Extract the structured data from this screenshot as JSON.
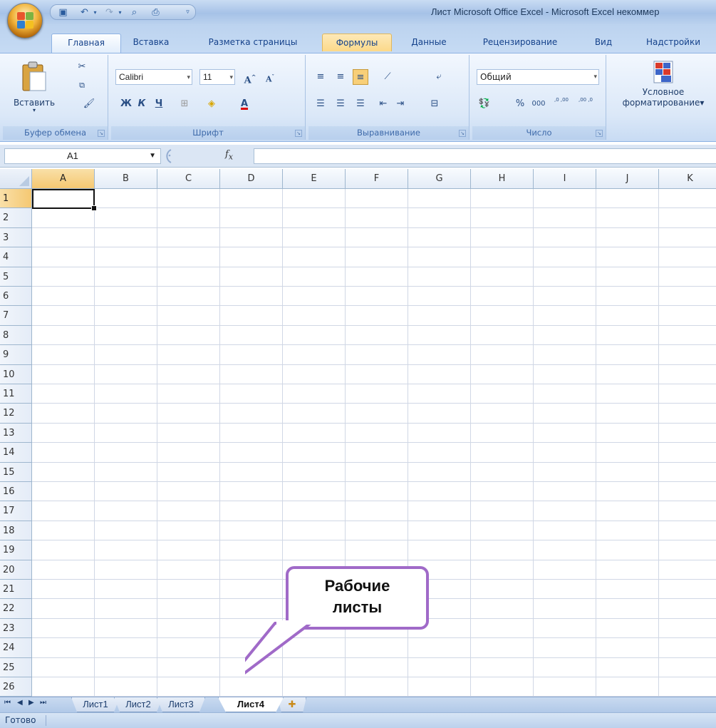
{
  "window": {
    "title": "Лист Microsoft Office Excel - Microsoft Excel некоммер"
  },
  "ribbon_tabs": [
    {
      "label": "Главная",
      "active": true
    },
    {
      "label": "Вставка"
    },
    {
      "label": "Разметка страницы"
    },
    {
      "label": "Формулы",
      "highlighted": true
    },
    {
      "label": "Данные"
    },
    {
      "label": "Рецензирование"
    },
    {
      "label": "Вид"
    },
    {
      "label": "Надстройки"
    }
  ],
  "clipboard": {
    "paste_label": "Вставить",
    "group_label": "Буфер обмена"
  },
  "font": {
    "name": "Calibri",
    "size": "11",
    "group_label": "Шрифт",
    "bold": "Ж",
    "italic": "К",
    "underline": "Ч"
  },
  "alignment": {
    "group_label": "Выравнивание"
  },
  "number": {
    "format": "Общий",
    "group_label": "Число",
    "percent": "%",
    "thousands": "000",
    "inc_decimal": ",0 ,00",
    "dec_decimal": ",00 ,0"
  },
  "styles": {
    "cond_format_line1": "Условное",
    "cond_format_line2": "форматирование"
  },
  "formula_bar": {
    "name_box": "A1",
    "fx": "fx",
    "value": ""
  },
  "columns": [
    "A",
    "B",
    "C",
    "D",
    "E",
    "F",
    "G",
    "H",
    "I",
    "J",
    "K"
  ],
  "rows": [
    "1",
    "2",
    "3",
    "4",
    "5",
    "6",
    "7",
    "8",
    "9",
    "10",
    "11",
    "12",
    "13",
    "14",
    "15",
    "16",
    "17",
    "18",
    "19",
    "20",
    "21",
    "22",
    "23",
    "24",
    "25",
    "26"
  ],
  "selected_cell": "A1",
  "sheet_tabs": [
    {
      "label": "Лист1"
    },
    {
      "label": "Лист2"
    },
    {
      "label": "Лист3"
    },
    {
      "label": "Лист4",
      "active": true
    }
  ],
  "status": {
    "text": "Готово"
  },
  "callout": {
    "line1": "Рабочие",
    "line2": "листы"
  },
  "colors": {
    "callout_border": "#a06ac8",
    "selected_header": "#f5c872",
    "ribbon_text": "#15428b"
  }
}
